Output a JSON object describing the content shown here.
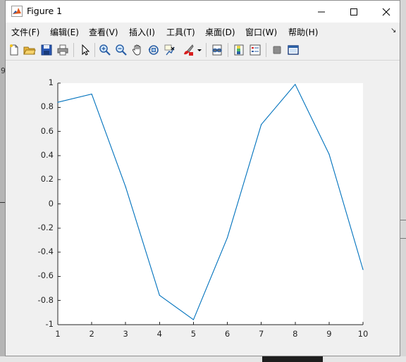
{
  "window": {
    "title": "Figure 1",
    "icon": "matlab-icon",
    "controls": [
      "minimize-icon",
      "maximize-icon",
      "close-icon"
    ]
  },
  "menu": {
    "items": [
      {
        "label": "文件(F)"
      },
      {
        "label": "编辑(E)"
      },
      {
        "label": "查看(V)"
      },
      {
        "label": "插入(I)"
      },
      {
        "label": "工具(T)"
      },
      {
        "label": "桌面(D)"
      },
      {
        "label": "窗口(W)"
      },
      {
        "label": "帮助(H)"
      }
    ],
    "pin_glyph": "↘"
  },
  "toolbar": {
    "icons": [
      "new-figure-icon",
      "open-file-icon",
      "save-icon",
      "print-icon",
      "edit-plot-arrow-icon",
      "zoom-in-icon",
      "zoom-out-icon",
      "pan-hand-icon",
      "rotate-3d-icon",
      "data-cursor-icon",
      "brush-icon",
      "brush-dropdown-icon",
      "link-plot-icon",
      "colorbar-icon",
      "legend-icon",
      "hide-plot-tools-icon",
      "show-plot-tools-icon"
    ]
  },
  "background": {
    "left_edge_char": "9"
  },
  "chart_data": {
    "type": "line",
    "x": [
      1,
      2,
      3,
      4,
      5,
      6,
      7,
      8,
      9,
      10
    ],
    "series": [
      {
        "values": [
          0.8415,
          0.9093,
          0.1411,
          -0.7568,
          -0.9589,
          -0.2794,
          0.657,
          0.9894,
          0.4121,
          -0.544
        ],
        "color": "#0072bd"
      }
    ],
    "xlim": [
      1,
      10
    ],
    "ylim": [
      -1,
      1
    ],
    "xticks": [
      "1",
      "2",
      "3",
      "4",
      "5",
      "6",
      "7",
      "8",
      "9",
      "10"
    ],
    "yticks": [
      "1",
      "0.8",
      "0.6",
      "0.4",
      "0.2",
      "0",
      "-0.2",
      "-0.4",
      "-0.6",
      "-0.8",
      "-1"
    ],
    "grid": false,
    "title": "",
    "xlabel": "",
    "ylabel": ""
  }
}
